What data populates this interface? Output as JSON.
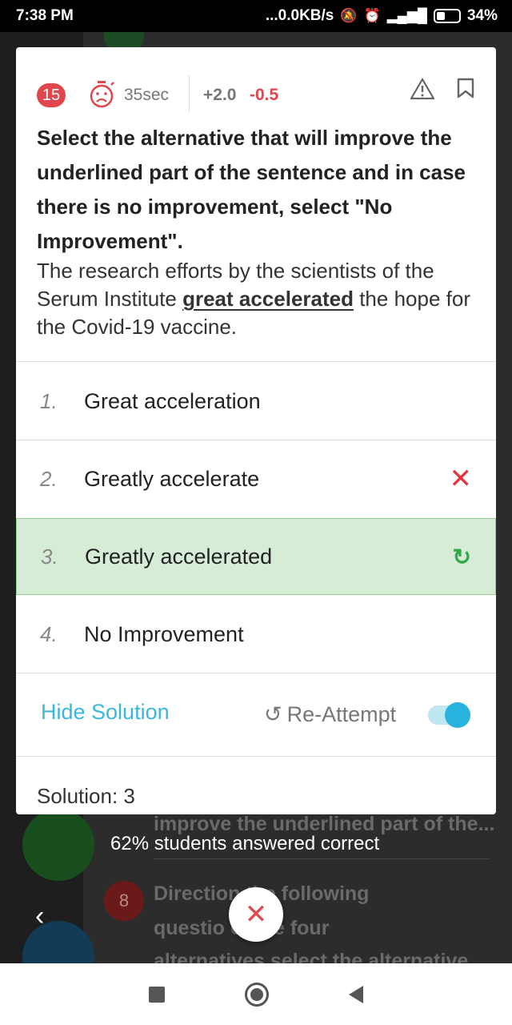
{
  "status_bar": {
    "time": "7:38 PM",
    "network_speed": "...0.0KB/s",
    "battery": "34%",
    "icons": [
      "mute-icon",
      "alarm-icon",
      "volte-icon",
      "signal-4g-icon",
      "battery-charging-icon"
    ]
  },
  "background": {
    "stat_text": "62% students answered correct",
    "question_snippet": "improve the underlined part of the...",
    "next_number": "8",
    "next_line1": "Direction the following",
    "next_line2": "questio of the four",
    "next_line3": "alternatives select the alternative"
  },
  "question": {
    "number": "15",
    "time": "35sec",
    "marks_positive": "+2.0",
    "marks_negative": "-0.5",
    "instruction": "Select the alternative that will improve the underlined part of the sentence and in case there is no improvement, select \"No Improvement\".",
    "sentence_before": "The research efforts by the scientists of the Serum Institute ",
    "sentence_underlined": "great accelerated",
    "sentence_after": " the hope for the Covid-19 vaccine."
  },
  "options": [
    {
      "num": "1.",
      "text": "Great acceleration"
    },
    {
      "num": "2.",
      "text": "Greatly accelerate",
      "mark": "✕"
    },
    {
      "num": "3.",
      "text": "Greatly accelerated",
      "mark": "↻"
    },
    {
      "num": "4.",
      "text": "No Improvement"
    }
  ],
  "footer": {
    "hide_solution": "Hide Solution",
    "reattempt": "Re-Attempt",
    "reattempt_icon": "↺",
    "solution": "Solution: 3"
  },
  "colors": {
    "accent": "#39b8d9",
    "wrong": "#e2363b",
    "correct_bg": "#d6ecd6",
    "badge": "#e0474c"
  }
}
